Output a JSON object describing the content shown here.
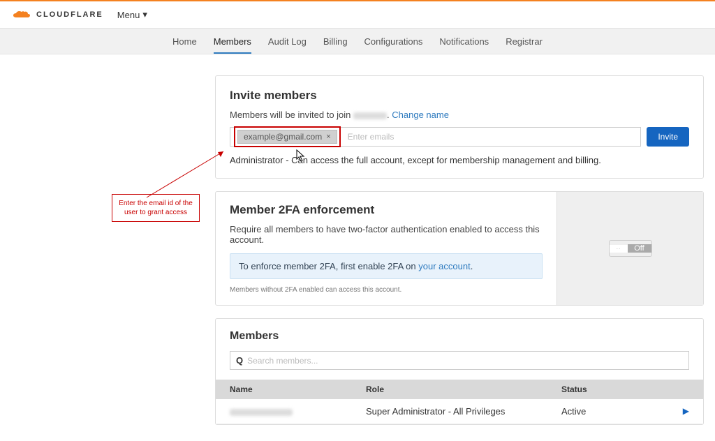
{
  "brand": "CLOUDFLARE",
  "menu_label": "Menu",
  "nav": {
    "items": [
      "Home",
      "Members",
      "Audit Log",
      "Billing",
      "Configurations",
      "Notifications",
      "Registrar"
    ],
    "active_index": 1
  },
  "invite": {
    "title": "Invite members",
    "prefix": "Members will be invited to join",
    "change_name": "Change name",
    "chip_email": "example@gmail.com",
    "placeholder": "Enter emails",
    "button": "Invite",
    "role_desc": "Administrator - Can access the full account, except for membership management and billing."
  },
  "twofa": {
    "title": "Member 2FA enforcement",
    "subtitle": "Require all members to have two-factor authentication enabled to access this account.",
    "info_prefix": "To enforce member 2FA, first enable 2FA on ",
    "info_link": "your account",
    "note": "Members without 2FA enabled can access this account.",
    "toggle_on": "··",
    "toggle_off": "Off"
  },
  "members": {
    "title": "Members",
    "search_placeholder": "Search members...",
    "headers": {
      "name": "Name",
      "role": "Role",
      "status": "Status"
    },
    "row": {
      "role": "Super Administrator - All Privileges",
      "status": "Active"
    }
  },
  "annotation": "Enter the email id of the user to grant access"
}
